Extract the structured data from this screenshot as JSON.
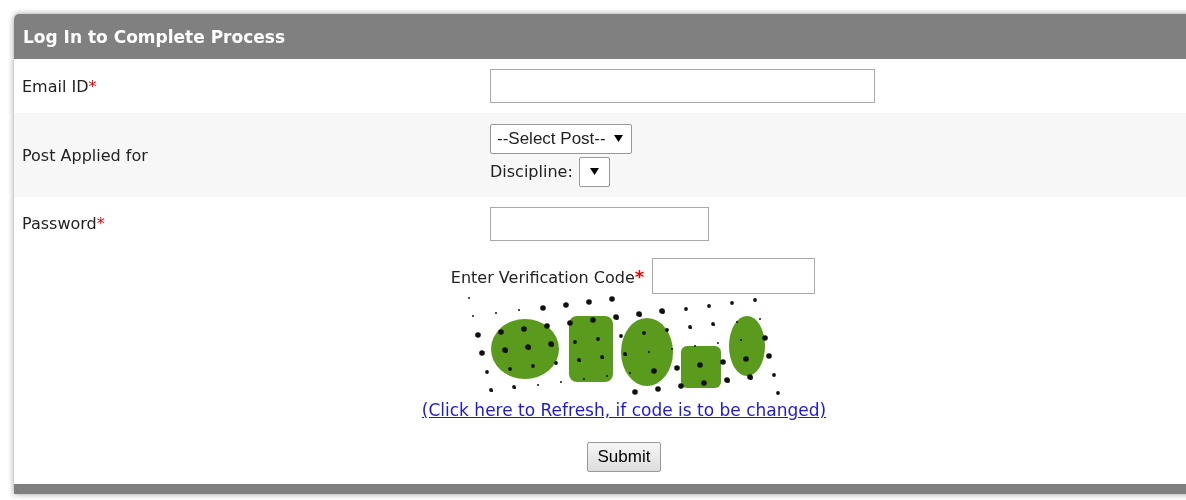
{
  "panel": {
    "title": "Log In to Complete Process"
  },
  "rows": [
    {
      "kind": "text",
      "label": "Email ID",
      "required_mark": "*",
      "value": ""
    },
    {
      "kind": "post",
      "label": "Post Applied for",
      "select": {
        "value": "--Select Post--"
      },
      "discipline": {
        "label": "Discipline:"
      }
    },
    {
      "kind": "password",
      "label": "Password",
      "required_mark": "*",
      "value": ""
    }
  ],
  "verification": {
    "label": "Enter Verification Code",
    "required_mark": "*",
    "refresh_link": "(Click here to Refresh, if code is to be changed)"
  },
  "submit": "Submit"
}
